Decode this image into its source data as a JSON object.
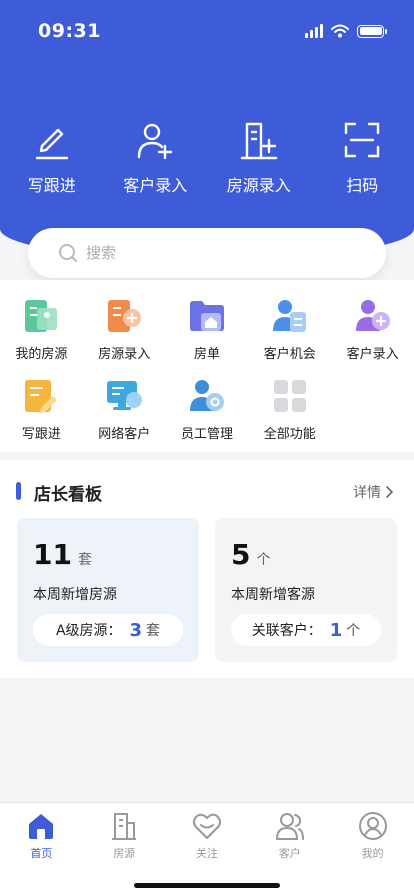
{
  "status_bar": {
    "time": "09:31"
  },
  "quick_actions": [
    {
      "label": "写跟进",
      "icon": "pencil-icon"
    },
    {
      "label": "客户录入",
      "icon": "add-user-icon"
    },
    {
      "label": "房源录入",
      "icon": "add-house-icon"
    },
    {
      "label": "扫码",
      "icon": "scan-icon"
    }
  ],
  "search": {
    "placeholder": "搜索"
  },
  "grid": [
    {
      "label": "我的房源",
      "icon": "my-listings-icon"
    },
    {
      "label": "房源录入",
      "icon": "listing-entry-icon"
    },
    {
      "label": "房单",
      "icon": "house-folder-icon"
    },
    {
      "label": "客户机会",
      "icon": "customer-opportunity-icon"
    },
    {
      "label": "客户录入",
      "icon": "customer-entry-icon"
    },
    {
      "label": "写跟进",
      "icon": "follow-up-icon"
    },
    {
      "label": "网络客户",
      "icon": "online-customer-icon"
    },
    {
      "label": "员工管理",
      "icon": "staff-management-icon"
    },
    {
      "label": "全部功能",
      "icon": "all-functions-icon"
    }
  ],
  "board": {
    "title": "店长看板",
    "more": "详情",
    "cards": [
      {
        "value": "11",
        "unit": "套",
        "desc": "本周新增房源",
        "pill_label": "A级房源：",
        "pill_value": "3",
        "pill_unit": "套"
      },
      {
        "value": "5",
        "unit": "个",
        "desc": "本周新增客源",
        "pill_label": "关联客户：",
        "pill_value": "1",
        "pill_unit": "个"
      }
    ]
  },
  "tabbar": [
    {
      "label": "首页",
      "icon": "home-icon",
      "active": true
    },
    {
      "label": "房源",
      "icon": "building-icon",
      "active": false
    },
    {
      "label": "关注",
      "icon": "heart-icon",
      "active": false
    },
    {
      "label": "客户",
      "icon": "users-icon",
      "active": false
    },
    {
      "label": "我的",
      "icon": "profile-icon",
      "active": false
    }
  ],
  "colors": {
    "primary": "#3e5bd8",
    "background": "#f4f5f7"
  }
}
